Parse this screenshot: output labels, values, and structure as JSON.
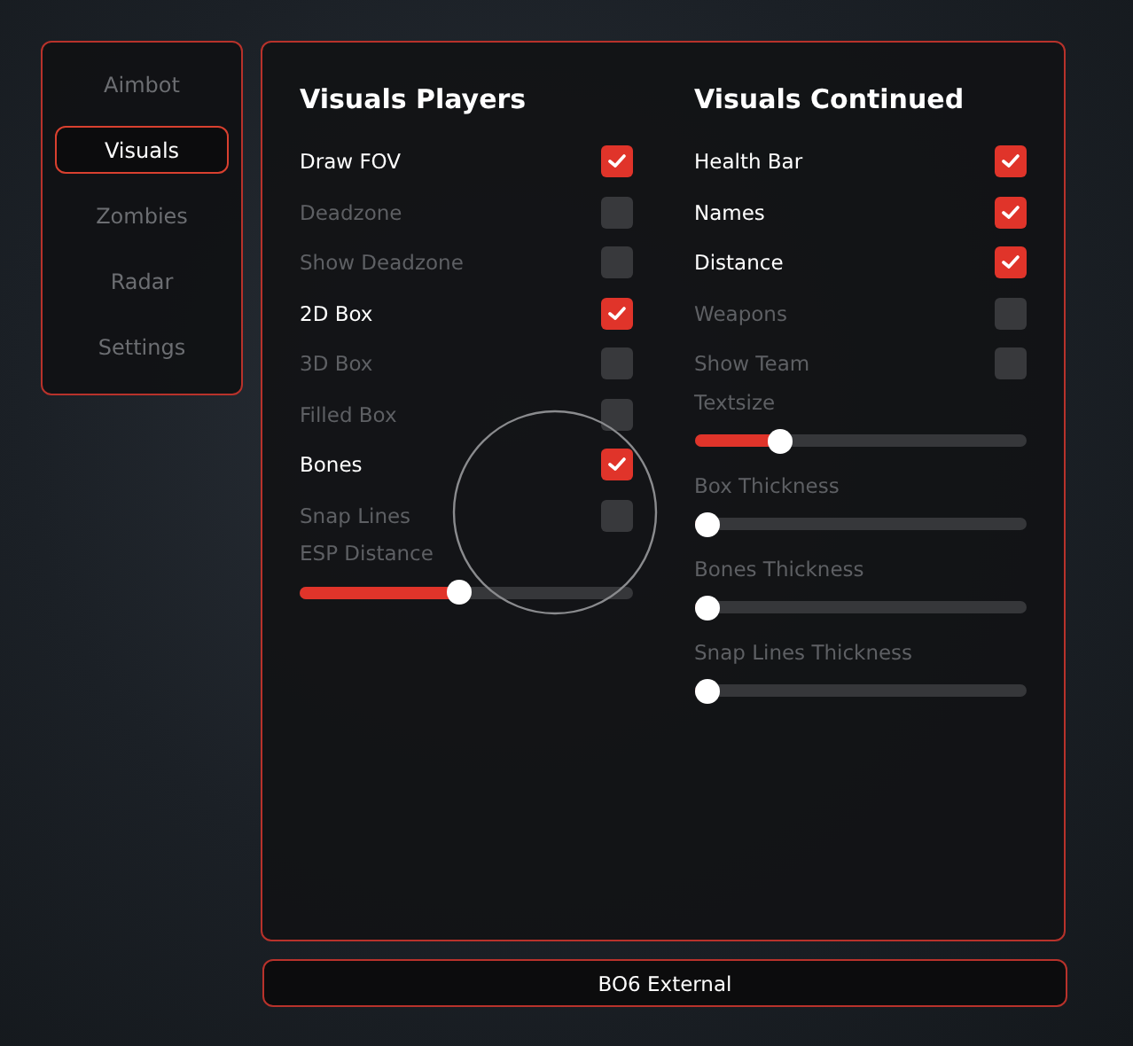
{
  "sidebar": {
    "items": [
      {
        "label": "Aimbot",
        "selected": false
      },
      {
        "label": "Visuals",
        "selected": true
      },
      {
        "label": "Zombies",
        "selected": false
      },
      {
        "label": "Radar",
        "selected": false
      },
      {
        "label": "Settings",
        "selected": false
      }
    ]
  },
  "columns": [
    {
      "title": "Visuals Players",
      "items": [
        {
          "kind": "checkbox",
          "label": "Draw FOV",
          "checked": true
        },
        {
          "kind": "checkbox",
          "label": "Deadzone",
          "checked": false
        },
        {
          "kind": "checkbox",
          "label": "Show Deadzone",
          "checked": false
        },
        {
          "kind": "checkbox",
          "label": "2D Box",
          "checked": true
        },
        {
          "kind": "checkbox",
          "label": "3D Box",
          "checked": false
        },
        {
          "kind": "checkbox",
          "label": "Filled Box",
          "checked": false
        },
        {
          "kind": "checkbox",
          "label": "Bones",
          "checked": true
        },
        {
          "kind": "checkbox",
          "label": "Snap Lines",
          "checked": false
        },
        {
          "kind": "slider",
          "label": "ESP Distance",
          "level": 0.48
        }
      ]
    },
    {
      "title": "Visuals Continued",
      "items": [
        {
          "kind": "checkbox",
          "label": "Health Bar",
          "checked": true
        },
        {
          "kind": "checkbox",
          "label": "Names",
          "checked": true
        },
        {
          "kind": "checkbox",
          "label": "Distance",
          "checked": true
        },
        {
          "kind": "checkbox",
          "label": "Weapons",
          "checked": false
        },
        {
          "kind": "checkbox",
          "label": "Show Team",
          "checked": false
        },
        {
          "kind": "slider",
          "label": "Textsize",
          "level": 0.24
        },
        {
          "kind": "slider",
          "label": "Box Thickness",
          "level": 0
        },
        {
          "kind": "slider",
          "label": "Bones Thickness",
          "level": 0
        },
        {
          "kind": "slider",
          "label": "Snap Lines Thickness",
          "level": 0
        }
      ]
    }
  ],
  "footer": {
    "title": "BO6 External"
  }
}
